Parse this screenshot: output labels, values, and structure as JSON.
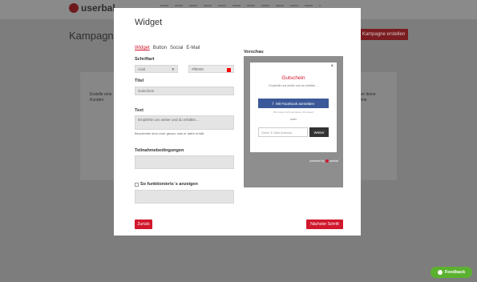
{
  "background": {
    "logo_text": "userbal",
    "page_title": "Kampagner",
    "cta_label": "Kampagne erstellen",
    "left_text_line1": "Erstelle eine",
    "left_text_line2": "Kunden",
    "right_text_line1": "dner deine",
    "right_text_line2": "r eine"
  },
  "modal": {
    "title": "Widget",
    "tabs": [
      {
        "label": "Widget",
        "active": true
      },
      {
        "label": "Button",
        "active": false
      },
      {
        "label": "Social",
        "active": false
      },
      {
        "label": "E-Mail",
        "active": false
      }
    ],
    "font_label": "Schriftart",
    "font_value": "Arial",
    "color_value": "#ff0000",
    "title_label": "Titel",
    "title_value": "Gutschein",
    "text_label": "Text",
    "text_value": "Empfehle uns weiter und du erhältst ...",
    "text_hint": "Beschreibe dem User genau, was er dafür erhält.",
    "terms_label": "Teilnahmebedingungen",
    "terms_value": "",
    "howto_label": "So funktionierts´s anzeigen",
    "howto_value": "",
    "preview_label": "Vorschau",
    "back_label": "Zurück",
    "next_label": "Nächster Schritt"
  },
  "preview": {
    "close": "×",
    "title": "Gutschein",
    "subtitle": "Empfehle uns weiter und du erhältst ...",
    "fb_icon": "f",
    "fb_label": "Mit Facebook anmelden",
    "fb_note": "Wir posten nicht auf deiner Pinnwand",
    "or_label": "oder",
    "email_placeholder": "Deine E-Mail Adresse",
    "submit_label": "Weiter",
    "powered_prefix": "powered by",
    "powered_brand": "userbal"
  },
  "feedback_label": "Feedback",
  "colors": {
    "accent": "#d0172c",
    "facebook": "#3b5998",
    "feedback": "#5bb12f"
  }
}
